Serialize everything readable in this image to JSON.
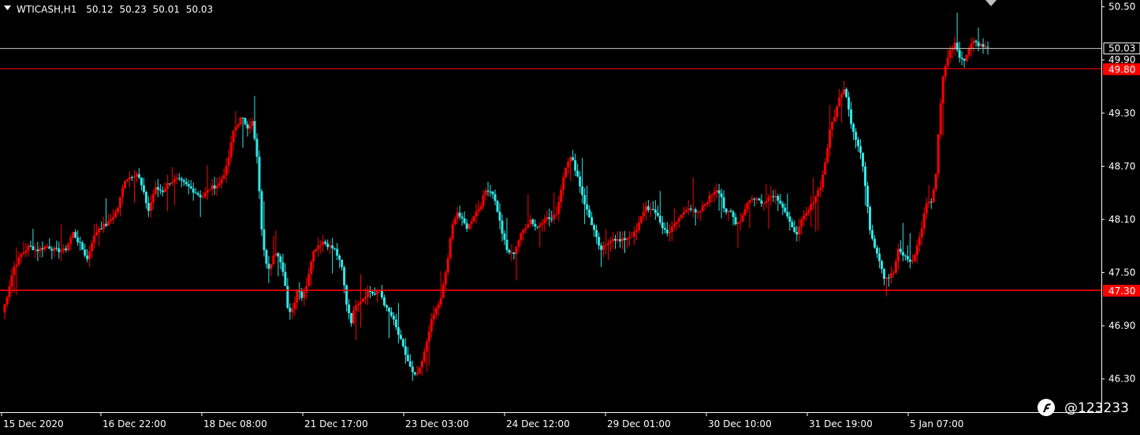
{
  "header": {
    "symbol": "WTICASH,H1",
    "open": "50.12",
    "high": "50.23",
    "low": "50.01",
    "close": "50.03"
  },
  "colors": {
    "background": "#000000",
    "bull": "#ff0000",
    "bear": "#33e6e6",
    "text": "#ffffff",
    "line_price": "#c8c8c8",
    "line_level": "#ff0000"
  },
  "watermark": {
    "handle": "@123233",
    "icon": "brand-logo-icon"
  },
  "chart_data": {
    "type": "candlestick",
    "timeframe": "H1",
    "ylim": [
      46.2,
      50.55
    ],
    "y_ticks": [
      "50.50",
      "49.90",
      "49.30",
      "48.70",
      "48.10",
      "47.50",
      "46.90",
      "46.30"
    ],
    "x_labels": [
      "15 Dec 2020",
      "16 Dec 22:00",
      "18 Dec 08:00",
      "21 Dec 17:00",
      "23 Dec 03:00",
      "24 Dec 12:00",
      "29 Dec 01:00",
      "30 Dec 10:00",
      "31 Dec 19:00",
      "5 Jan 07:00"
    ],
    "current_price": "50.03",
    "price_labels": [
      {
        "value": "50.03",
        "kind": "current"
      },
      {
        "value": "49.90",
        "kind": "tick"
      }
    ],
    "levels": [
      {
        "value": 49.8,
        "label": "49.80"
      },
      {
        "value": 47.3,
        "label": "47.30"
      }
    ],
    "path": [
      [
        0,
        47.05
      ],
      [
        5,
        47.2
      ],
      [
        14,
        47.55
      ],
      [
        24,
        47.7
      ],
      [
        34,
        47.8
      ],
      [
        44,
        47.75
      ],
      [
        56,
        47.8
      ],
      [
        68,
        47.75
      ],
      [
        80,
        47.75
      ],
      [
        90,
        47.95
      ],
      [
        100,
        47.8
      ],
      [
        108,
        47.65
      ],
      [
        114,
        47.85
      ],
      [
        122,
        48.0
      ],
      [
        134,
        48.05
      ],
      [
        146,
        48.2
      ],
      [
        156,
        48.55
      ],
      [
        166,
        48.6
      ],
      [
        172,
        48.62
      ],
      [
        178,
        48.45
      ],
      [
        186,
        48.2
      ],
      [
        194,
        48.45
      ],
      [
        204,
        48.42
      ],
      [
        212,
        48.52
      ],
      [
        222,
        48.55
      ],
      [
        232,
        48.5
      ],
      [
        244,
        48.42
      ],
      [
        254,
        48.35
      ],
      [
        264,
        48.45
      ],
      [
        276,
        48.5
      ],
      [
        286,
        48.7
      ],
      [
        294,
        49.1
      ],
      [
        304,
        49.25
      ],
      [
        312,
        49.15
      ],
      [
        318,
        49.2
      ],
      [
        324,
        48.8
      ],
      [
        330,
        48.0
      ],
      [
        334,
        47.65
      ],
      [
        340,
        47.55
      ],
      [
        346,
        47.75
      ],
      [
        352,
        47.65
      ],
      [
        358,
        47.5
      ],
      [
        364,
        47.05
      ],
      [
        370,
        47.1
      ],
      [
        376,
        47.35
      ],
      [
        382,
        47.2
      ],
      [
        388,
        47.4
      ],
      [
        394,
        47.7
      ],
      [
        400,
        47.8
      ],
      [
        408,
        47.85
      ],
      [
        416,
        47.8
      ],
      [
        424,
        47.75
      ],
      [
        432,
        47.55
      ],
      [
        438,
        47.15
      ],
      [
        444,
        46.95
      ],
      [
        450,
        47.15
      ],
      [
        458,
        47.2
      ],
      [
        466,
        47.3
      ],
      [
        474,
        47.25
      ],
      [
        480,
        47.3
      ],
      [
        488,
        47.1
      ],
      [
        496,
        47.0
      ],
      [
        504,
        46.8
      ],
      [
        512,
        46.6
      ],
      [
        518,
        46.45
      ],
      [
        524,
        46.32
      ],
      [
        530,
        46.38
      ],
      [
        536,
        46.55
      ],
      [
        544,
        46.9
      ],
      [
        550,
        47.05
      ],
      [
        558,
        47.2
      ],
      [
        566,
        47.6
      ],
      [
        572,
        48.0
      ],
      [
        578,
        48.2
      ],
      [
        584,
        48.1
      ],
      [
        592,
        48.0
      ],
      [
        600,
        48.15
      ],
      [
        608,
        48.25
      ],
      [
        616,
        48.45
      ],
      [
        624,
        48.4
      ],
      [
        630,
        48.2
      ],
      [
        636,
        47.95
      ],
      [
        642,
        47.75
      ],
      [
        650,
        47.7
      ],
      [
        656,
        47.85
      ],
      [
        664,
        48.0
      ],
      [
        672,
        48.1
      ],
      [
        680,
        48.0
      ],
      [
        690,
        48.12
      ],
      [
        700,
        48.1
      ],
      [
        706,
        48.2
      ],
      [
        712,
        48.5
      ],
      [
        718,
        48.75
      ],
      [
        724,
        48.8
      ],
      [
        730,
        48.65
      ],
      [
        736,
        48.45
      ],
      [
        742,
        48.25
      ],
      [
        748,
        48.1
      ],
      [
        754,
        47.95
      ],
      [
        760,
        47.75
      ],
      [
        768,
        47.8
      ],
      [
        776,
        47.9
      ],
      [
        786,
        47.85
      ],
      [
        796,
        47.9
      ],
      [
        806,
        47.95
      ],
      [
        812,
        48.1
      ],
      [
        818,
        48.25
      ],
      [
        826,
        48.2
      ],
      [
        834,
        48.15
      ],
      [
        840,
        48.0
      ],
      [
        848,
        47.95
      ],
      [
        856,
        48.05
      ],
      [
        864,
        48.15
      ],
      [
        872,
        48.25
      ],
      [
        878,
        48.2
      ],
      [
        884,
        48.15
      ],
      [
        892,
        48.25
      ],
      [
        900,
        48.35
      ],
      [
        908,
        48.45
      ],
      [
        914,
        48.4
      ],
      [
        920,
        48.15
      ],
      [
        926,
        48.2
      ],
      [
        934,
        48.05
      ],
      [
        940,
        48.1
      ],
      [
        948,
        48.3
      ],
      [
        958,
        48.35
      ],
      [
        966,
        48.28
      ],
      [
        974,
        48.35
      ],
      [
        982,
        48.38
      ],
      [
        990,
        48.3
      ],
      [
        998,
        48.15
      ],
      [
        1004,
        48.0
      ],
      [
        1012,
        47.95
      ],
      [
        1018,
        48.1
      ],
      [
        1026,
        48.2
      ],
      [
        1034,
        48.35
      ],
      [
        1042,
        48.5
      ],
      [
        1048,
        48.8
      ],
      [
        1054,
        49.15
      ],
      [
        1060,
        49.3
      ],
      [
        1066,
        49.5
      ],
      [
        1072,
        49.6
      ],
      [
        1076,
        49.4
      ],
      [
        1080,
        49.2
      ],
      [
        1086,
        49.0
      ],
      [
        1092,
        48.85
      ],
      [
        1098,
        48.5
      ],
      [
        1104,
        48.0
      ],
      [
        1110,
        47.8
      ],
      [
        1116,
        47.65
      ],
      [
        1122,
        47.45
      ],
      [
        1128,
        47.45
      ],
      [
        1134,
        47.5
      ],
      [
        1140,
        47.75
      ],
      [
        1146,
        47.7
      ],
      [
        1152,
        47.65
      ],
      [
        1158,
        47.62
      ],
      [
        1164,
        47.8
      ],
      [
        1170,
        48.0
      ],
      [
        1176,
        48.3
      ],
      [
        1182,
        48.3
      ],
      [
        1188,
        48.6
      ],
      [
        1192,
        49.2
      ],
      [
        1196,
        49.65
      ],
      [
        1200,
        49.85
      ],
      [
        1206,
        50.0
      ],
      [
        1212,
        50.1
      ],
      [
        1218,
        49.95
      ],
      [
        1224,
        49.88
      ],
      [
        1230,
        50.05
      ],
      [
        1236,
        50.12
      ],
      [
        1242,
        50.08
      ],
      [
        1248,
        50.05
      ],
      [
        1254,
        50.03
      ]
    ]
  }
}
